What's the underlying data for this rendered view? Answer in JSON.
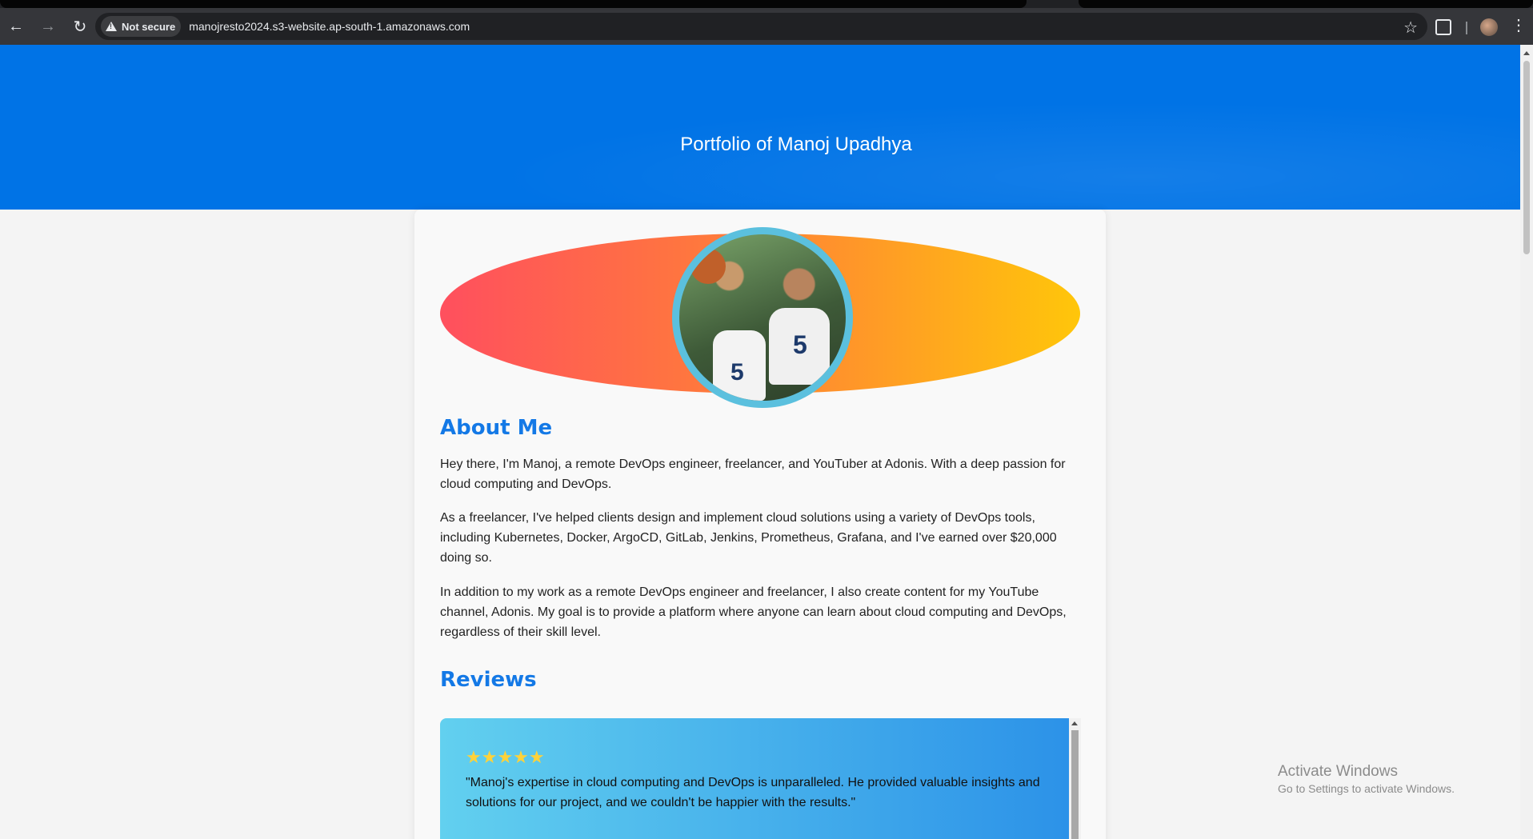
{
  "browser": {
    "security_label": "Not secure",
    "url": "manojresto2024.s3-website.ap-south-1.amazonaws.com"
  },
  "hero": {
    "title": "Portfolio of Manoj Upadhya",
    "background": "#0073e6"
  },
  "about": {
    "heading": "About Me",
    "paragraphs": [
      "Hey there, I'm Manoj, a remote DevOps engineer, freelancer, and YouTuber at Adonis. With a deep passion for cloud computing and DevOps.",
      "As a freelancer, I've helped clients design and implement cloud solutions using a variety of DevOps tools, including Kubernetes, Docker, ArgoCD, GitLab, Jenkins, Prometheus, Grafana, and I've earned over $20,000 doing so.",
      "In addition to my work as a remote DevOps engineer and freelancer, I also create content for my YouTube channel, Adonis. My goal is to provide a platform where anyone can learn about cloud computing and DevOps, regardless of their skill level."
    ]
  },
  "reviews": {
    "heading": "Reviews",
    "items": [
      {
        "rating": 5,
        "stars": "★★★★★",
        "text": "\"Manoj's expertise in cloud computing and DevOps is unparalleled. He provided valuable insights and solutions for our project, and we couldn't be happier with the results.\""
      }
    ]
  },
  "profile_photo": {
    "jersey_number": "5",
    "border_color": "#5bc0de"
  },
  "os_watermark": {
    "line1": "Activate Windows",
    "line2": "Go to Settings to activate Windows."
  },
  "colors": {
    "accent_heading": "#1479e6",
    "ellipse_start": "#ff4f5e",
    "ellipse_end": "#ffc60a"
  }
}
